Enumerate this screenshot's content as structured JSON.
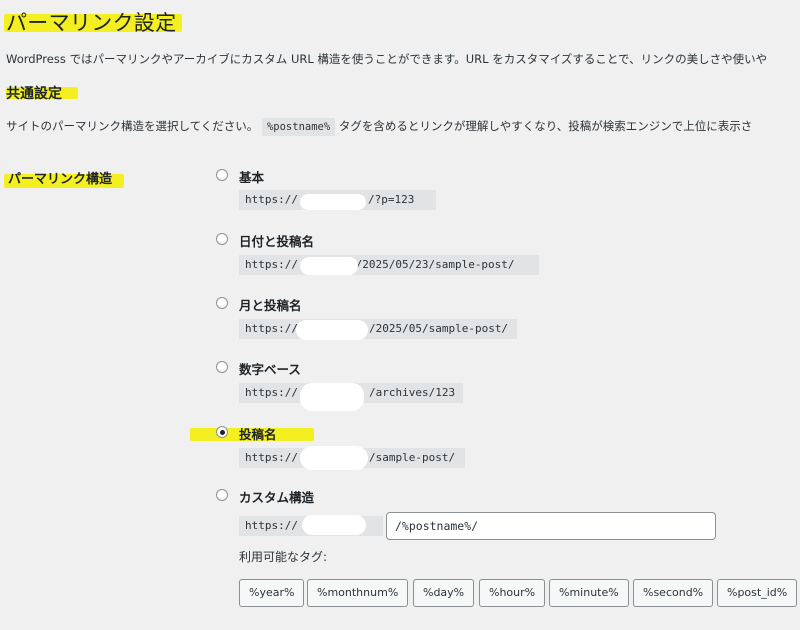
{
  "page": {
    "title": "パーマリンク設定",
    "description": "WordPress ではパーマリンクやアーカイブにカスタム URL 構造を使うことができます。URL をカスタマイズすることで、リンクの美しさや使いや"
  },
  "common": {
    "heading": "共通設定",
    "desc_before": "サイトのパーマリンク構造を選択してください。",
    "desc_code": "%postname%",
    "desc_after": "タグを含めるとリンクが理解しやすくなり、投稿が検索エンジンで上位に表示さ"
  },
  "permalink": {
    "row_label": "パーマリンク構造",
    "options": [
      {
        "label": "基本",
        "url_prefix": "https://",
        "url_suffix": "/?p=123",
        "checked": false
      },
      {
        "label": "日付と投稿名",
        "url_prefix": "https://",
        "url_suffix": "n/2025/05/23/sample-post/",
        "checked": false
      },
      {
        "label": "月と投稿名",
        "url_prefix": "https://",
        "url_suffix": "/2025/05/sample-post/",
        "checked": false
      },
      {
        "label": "数字ベース",
        "url_prefix": "https://",
        "url_suffix": "/archives/123",
        "checked": false
      },
      {
        "label": "投稿名",
        "url_prefix": "https://",
        "url_suffix": "/sample-post/",
        "checked": true
      },
      {
        "label": "カスタム構造",
        "url_prefix": "https://",
        "url_suffix": "",
        "checked": false
      }
    ],
    "custom_value": "/%postname%/",
    "tags_label": "利用可能なタグ:",
    "tags": [
      "%year%",
      "%monthnum%",
      "%day%",
      "%hour%",
      "%minute%",
      "%second%",
      "%post_id%"
    ]
  },
  "colors": {
    "background": "#f0f0f1",
    "highlight": "#f4ef21",
    "code_background": "#e2e3e4"
  }
}
